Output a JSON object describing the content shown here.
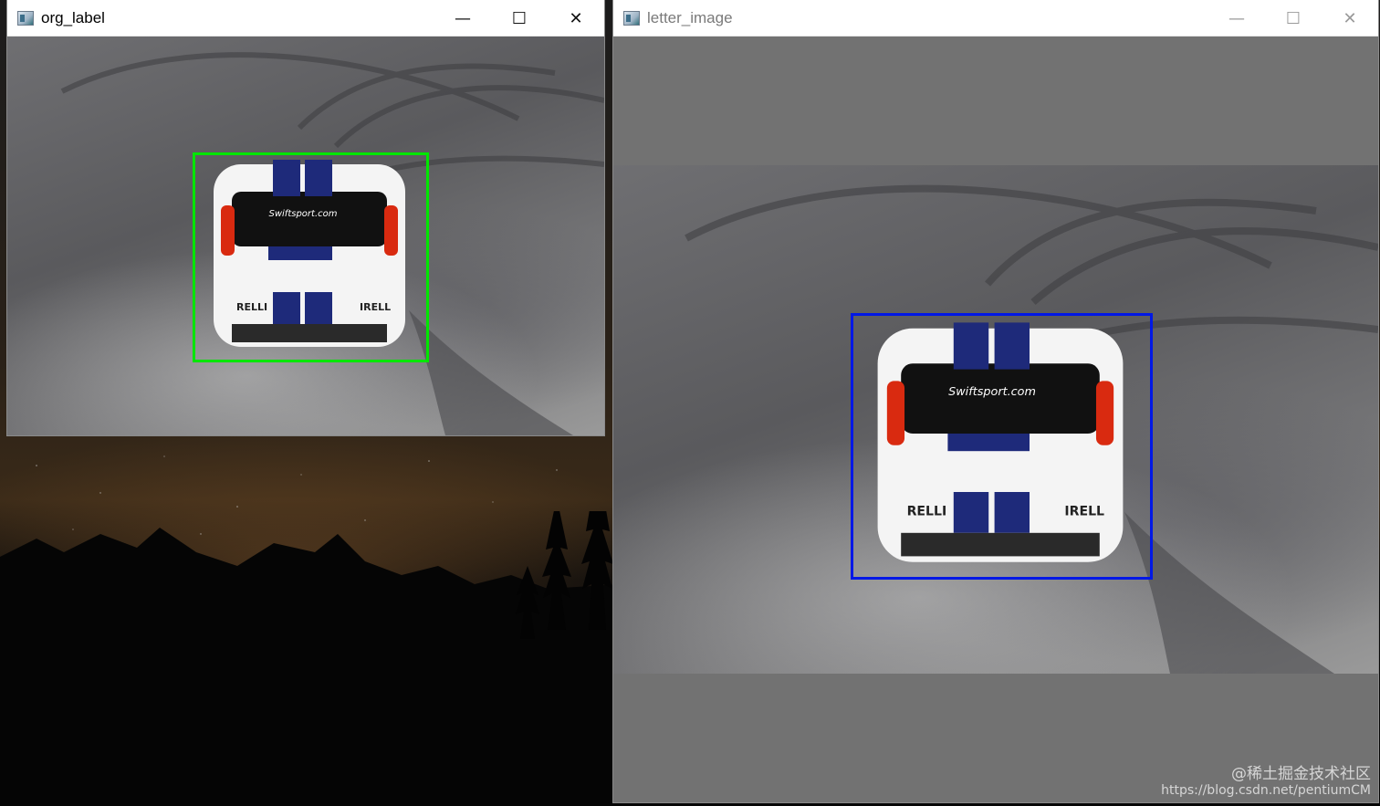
{
  "windows": [
    {
      "id": "org",
      "title": "org_label",
      "state": "active",
      "controls": {
        "minimize": "—",
        "maximize": "☐",
        "close": "✕"
      },
      "bbox_color": "#00ff00"
    },
    {
      "id": "letter",
      "title": "letter_image",
      "state": "inactive",
      "controls": {
        "minimize": "—",
        "maximize": "☐",
        "close": "✕"
      },
      "bbox_color": "#0000ff",
      "letterbox_color": "#727272"
    }
  ],
  "car": {
    "plate_text": "Swiftsport.com",
    "tire_brand": "IRELLI",
    "stripe_color": "#1e2a7a"
  },
  "watermark": {
    "line1": "@稀土掘金技术社区",
    "line2": "https://blog.csdn.net/pentiumCM"
  }
}
